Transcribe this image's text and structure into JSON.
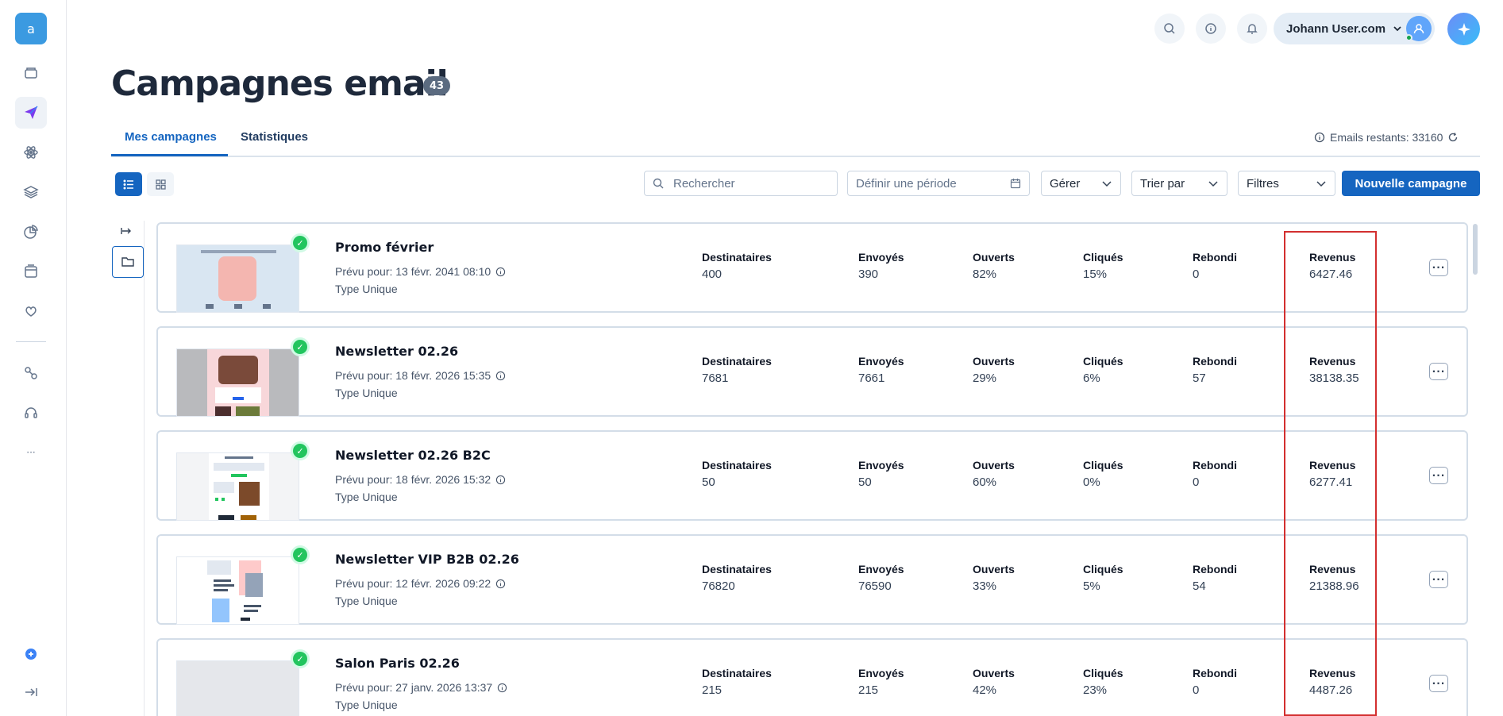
{
  "sidebar": {
    "logo_letter": "a",
    "icons": [
      "wallet-icon",
      "send-icon",
      "atom-icon",
      "layers-icon",
      "chart-pie-icon",
      "window-icon",
      "heart-hand-icon",
      "automation-icon",
      "headset-icon",
      "more-icon",
      "help-icon",
      "expand-icon"
    ],
    "more_label": "···"
  },
  "header": {
    "user_name": "Johann User.com"
  },
  "page": {
    "title": "Campagnes email",
    "count": "43"
  },
  "tabs": [
    {
      "label": "Mes campagnes",
      "active": true
    },
    {
      "label": "Statistiques",
      "active": false
    }
  ],
  "emails_remaining": "Emails restants: 33160",
  "toolbar": {
    "search_placeholder": "Rechercher",
    "period_placeholder": "Définir une période",
    "manage_label": "Gérer",
    "sort_label": "Trier par",
    "filters_label": "Filtres",
    "new_campaign_label": "Nouvelle campagne"
  },
  "metric_labels": {
    "recipients": "Destinataires",
    "sent": "Envoyés",
    "opened": "Ouverts",
    "clicked": "Cliqués",
    "bounced": "Rebondi",
    "revenue": "Revenus"
  },
  "campaigns": [
    {
      "name": "Promo février",
      "scheduled": "Prévu pour: 13 févr. 2041 08:10",
      "type": "Type Unique",
      "recipients": "400",
      "sent": "390",
      "opened": "82%",
      "clicked": "15%",
      "bounced": "0",
      "revenue": "6427.46"
    },
    {
      "name": "Newsletter 02.26",
      "scheduled": "Prévu pour: 18 févr. 2026 15:35",
      "type": "Type Unique",
      "recipients": "7681",
      "sent": "7661",
      "opened": "29%",
      "clicked": "6%",
      "bounced": "57",
      "revenue": "38138.35"
    },
    {
      "name": "Newsletter 02.26 B2C",
      "scheduled": "Prévu pour: 18 févr. 2026 15:32",
      "type": "Type Unique",
      "recipients": "50",
      "sent": "50",
      "opened": "60%",
      "clicked": "0%",
      "bounced": "0",
      "revenue": "6277.41"
    },
    {
      "name": "Newsletter VIP B2B 02.26",
      "scheduled": "Prévu pour: 12 févr. 2026 09:22",
      "type": "Type Unique",
      "recipients": "76820",
      "sent": "76590",
      "opened": "33%",
      "clicked": "5%",
      "bounced": "54",
      "revenue": "21388.96"
    },
    {
      "name": "Salon Paris 02.26",
      "scheduled": "Prévu pour: 27 janv. 2026 13:37",
      "type": "Type Unique",
      "recipients": "215",
      "sent": "215",
      "opened": "42%",
      "clicked": "23%",
      "bounced": "0",
      "revenue": "4487.26"
    }
  ],
  "colors": {
    "primary": "#1565c0",
    "highlight": "#d32f2f",
    "success": "#22c55e"
  }
}
